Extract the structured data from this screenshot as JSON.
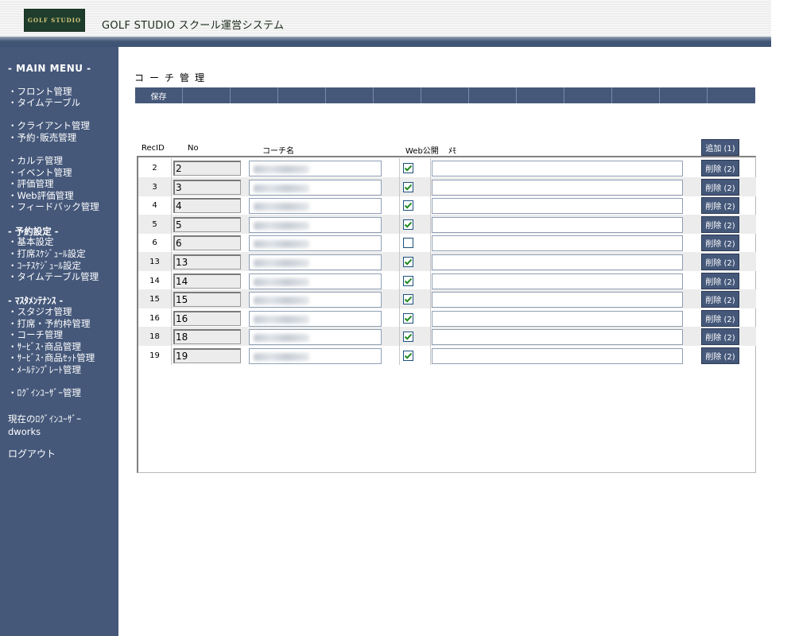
{
  "header": {
    "logo_text": "GOLF STUDIO",
    "title": "GOLF STUDIO スクール運営システム"
  },
  "sidebar": {
    "main_menu": "- MAIN MENU -",
    "group1": [
      "・フロント管理",
      "・タイムテーブル"
    ],
    "group2": [
      "・クライアント管理",
      "・予約･販売管理"
    ],
    "group3": [
      "・カルテ管理",
      "・イベント管理",
      "・評価管理",
      "・Web評価管理",
      "・フィードバック管理"
    ],
    "reservation_head": "- 予約設定 -",
    "group4": [
      "・基本設定",
      "・打席ｽｹｼﾞｭｰﾙ設定",
      "・ｺｰﾁｽｹｼﾞｭｰﾙ設定",
      "・タイムテーブル管理"
    ],
    "master_head": "- ﾏｽﾀﾒﾝﾃﾅﾝｽ -",
    "group5": [
      "・スタジオ管理",
      "・打席・予約枠管理",
      "・コーチ管理",
      "・ｻｰﾋﾞｽ･商品管理",
      "・ｻｰﾋﾞｽ･商品ｾｯﾄ管理",
      "・ﾒｰﾙﾃﾝﾌﾟﾚｰﾄ管理"
    ],
    "login_user_mgmt": "・ﾛｸﾞｲﾝﾕｰｻﾞｰ管理",
    "current_user_label": "現在のﾛｸﾞｲﾝﾕｰｻﾞｰ",
    "current_user": "dworks",
    "logout": "ログアウト"
  },
  "main": {
    "page_title": "コーチ管理",
    "save_label": "保存",
    "columns": {
      "recid": "RecID",
      "no": "No",
      "coach_name": "コーチ名",
      "web_public": "Web公開",
      "memo": "ﾒﾓ"
    },
    "add_label": "追加 (1)",
    "delete_label": "削除 (2)",
    "rows": [
      {
        "recid": "2",
        "no": "2",
        "web_public": true
      },
      {
        "recid": "3",
        "no": "3",
        "web_public": true
      },
      {
        "recid": "4",
        "no": "4",
        "web_public": true
      },
      {
        "recid": "5",
        "no": "5",
        "web_public": true
      },
      {
        "recid": "6",
        "no": "6",
        "web_public": false
      },
      {
        "recid": "13",
        "no": "13",
        "web_public": true
      },
      {
        "recid": "14",
        "no": "14",
        "web_public": true
      },
      {
        "recid": "15",
        "no": "15",
        "web_public": true
      },
      {
        "recid": "16",
        "no": "16",
        "web_public": true
      },
      {
        "recid": "18",
        "no": "18",
        "web_public": true
      },
      {
        "recid": "19",
        "no": "19",
        "web_public": true
      }
    ]
  },
  "colors": {
    "nav_bg": "#45587a",
    "logo_bg": "#1f3d2c"
  }
}
